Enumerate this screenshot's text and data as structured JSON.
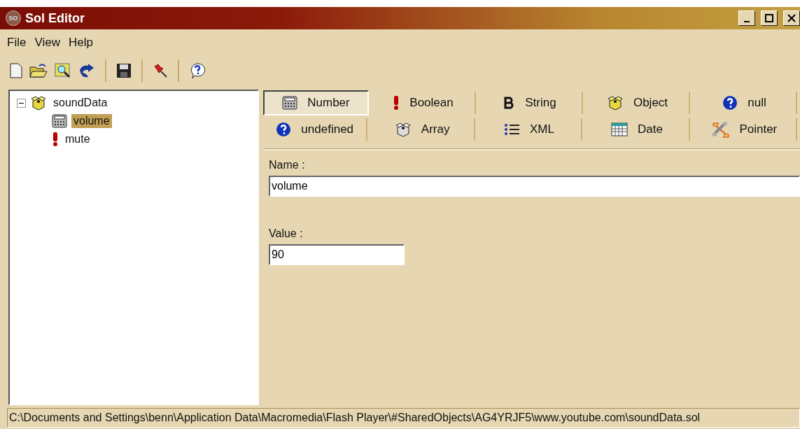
{
  "window": {
    "logo": "SO",
    "title": "Sol Editor"
  },
  "menu": [
    "File",
    "View",
    "Help"
  ],
  "toolbar": [
    {
      "kind": "new"
    },
    {
      "kind": "open"
    },
    {
      "kind": "find"
    },
    {
      "kind": "refresh"
    },
    {
      "kind": "sep"
    },
    {
      "kind": "save"
    },
    {
      "kind": "sep"
    },
    {
      "kind": "pin"
    },
    {
      "kind": "sep"
    },
    {
      "kind": "help"
    }
  ],
  "tree": [
    {
      "label": "soundData",
      "kind": "object",
      "selected": false,
      "expanded": true,
      "children": [
        {
          "label": "volume",
          "kind": "number",
          "selected": true
        },
        {
          "label": "mute",
          "kind": "boolean",
          "selected": false
        }
      ]
    }
  ],
  "type_rows": [
    [
      {
        "label": "Number",
        "kind": "number",
        "selected": true
      },
      {
        "label": "Boolean",
        "kind": "boolean",
        "selected": false
      },
      {
        "label": "String",
        "kind": "string",
        "selected": false
      },
      {
        "label": "Object",
        "kind": "object",
        "selected": false
      },
      {
        "label": "null",
        "kind": "question",
        "selected": false
      }
    ],
    [
      {
        "label": "undefined",
        "kind": "question",
        "selected": false
      },
      {
        "label": "Array",
        "kind": "array",
        "selected": false
      },
      {
        "label": "XML",
        "kind": "list",
        "selected": false
      },
      {
        "label": "Date",
        "kind": "date",
        "selected": false
      },
      {
        "label": "Pointer",
        "kind": "pointer",
        "selected": false
      }
    ]
  ],
  "name": {
    "label": "Name :",
    "value": "volume"
  },
  "value": {
    "label": "Value :",
    "value": "90"
  },
  "status_bar": "C:\\Documents and Settings\\benn\\Application Data\\Macromedia\\Flash Player\\#SharedObjects\\AG4YRJF5\\www.youtube.com\\soundData.sol"
}
